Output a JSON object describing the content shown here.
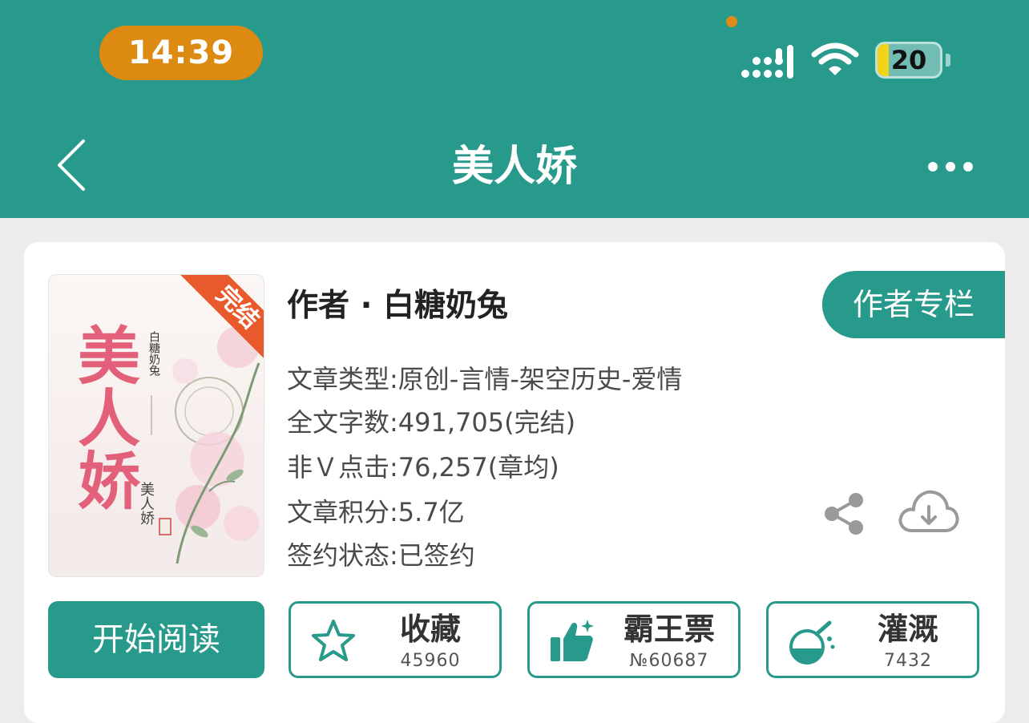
{
  "status_bar": {
    "time": "14:39",
    "battery_level": "20",
    "icons": [
      "signal-icon",
      "wifi-icon",
      "battery-icon"
    ],
    "accent_color": "#dc8a12"
  },
  "nav": {
    "title": "美人娇",
    "back_icon": "chevron-left-icon",
    "more_icon": "more-dots-icon"
  },
  "book": {
    "cover": {
      "title": "美人娇",
      "author": "白糖奶兔",
      "subtitle": "美人娇",
      "ribbon": "完结"
    },
    "author_line": "作者 · 白糖奶兔",
    "author_column_button": "作者专栏",
    "info": [
      "文章类型:原创-言情-架空历史-爱情",
      "全文字数:491,705(完结)",
      "非Ｖ点击:76,257(章均)",
      "文章积分:5.7亿",
      "签约状态:已签约"
    ]
  },
  "actions": {
    "read_button": "开始阅读",
    "buttons": [
      {
        "label": "收藏",
        "count": "45960",
        "icon": "star-icon"
      },
      {
        "label": "霸王票",
        "count": "№60687",
        "icon": "thumbs-up-icon"
      },
      {
        "label": "灌溉",
        "count": "7432",
        "icon": "flask-icon"
      }
    ]
  },
  "colors": {
    "primary": "#279a8b",
    "background": "#ececec",
    "card": "#ffffff",
    "ribbon": "#e8592b",
    "cover_title": "#e2607a"
  }
}
